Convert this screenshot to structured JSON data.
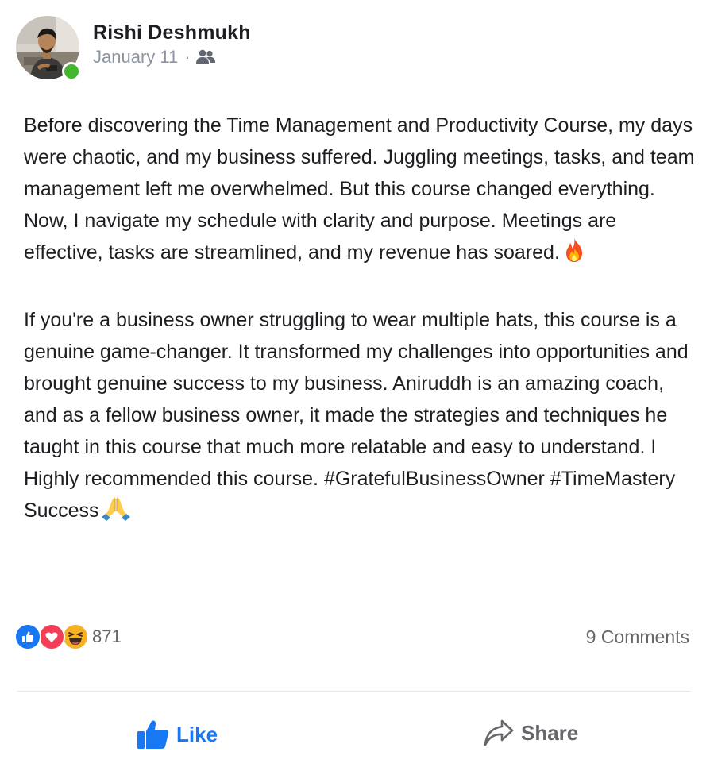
{
  "post": {
    "author": "Rishi Deshmukh",
    "date": "January 11",
    "separator": "·",
    "audience_icon": "friends-icon",
    "paragraphs": [
      {
        "text": "Before discovering the Time Management and Productivity Course, my days were chaotic, and my business suffered. Juggling meetings, tasks, and team management left me overwhelmed. But this course changed everything. Now, I navigate my schedule with clarity and purpose. Meetings are effective, tasks are streamlined, and my revenue has soared.",
        "emoji": "fire"
      },
      {
        "text": "If you're a business owner struggling to wear multiple hats, this course is a genuine game-changer. It transformed my challenges into opportunities and brought genuine success to my business. Aniruddh is an amazing coach, and as a fellow business owner, it made the strategies and techniques he taught in this course that much more relatable and easy to understand. I Highly recommended this course. #GratefulBusinessOwner #TimeMastery Success",
        "emoji": "folded-hands"
      }
    ]
  },
  "stats": {
    "reactions": [
      "like",
      "love",
      "haha"
    ],
    "reaction_count": "871",
    "comments": "9 Comments"
  },
  "actions": {
    "like_label": "Like",
    "share_label": "Share"
  },
  "colors": {
    "primary": "#1877f2",
    "text": "#1c1e21",
    "secondary": "#65676b",
    "online": "#42b72a"
  }
}
